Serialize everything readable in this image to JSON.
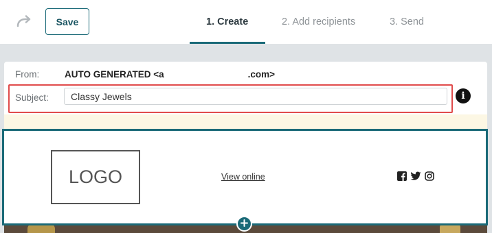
{
  "toolbar": {
    "save_label": "Save",
    "redo_icon": "redo-icon"
  },
  "steps": [
    {
      "label": "1. Create",
      "active": true
    },
    {
      "label": "2. Add recipients",
      "active": false
    },
    {
      "label": "3. Send",
      "active": false
    }
  ],
  "header": {
    "from_label": "From:",
    "from_value_start": "AUTO GENERATED <a",
    "from_value_end": ".com>",
    "subject_label": "Subject:",
    "subject_value": "Classy Jewels",
    "info_icon": "info-icon"
  },
  "email": {
    "logo_text": "LOGO",
    "view_online_label": "View online",
    "social_icons": [
      "facebook-icon",
      "twitter-icon",
      "instagram-icon"
    ],
    "add_block_icon": "plus-icon"
  },
  "colors": {
    "accent": "#1a6a78",
    "highlight": "#e04b4b",
    "notice_bg": "#fcf7e4",
    "page_bg": "#dfe3e6"
  }
}
